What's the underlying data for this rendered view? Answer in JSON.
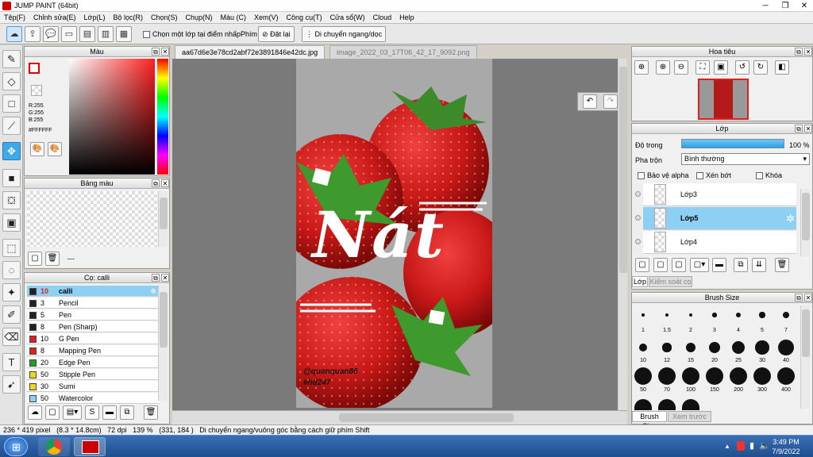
{
  "window": {
    "title": "JUMP PAINT (64bit)"
  },
  "menu": [
    "Tệp(F)",
    "Chỉnh sửa(E)",
    "Lớp(L)",
    "Bộ lọc(R)",
    "Chọn(S)",
    "Chụp(N)",
    "Màu (C)",
    "Xem(V)",
    "Công cụ(T)",
    "Cửa sổ(W)",
    "Cloud",
    "Help"
  ],
  "toolbar": {
    "select_one_layer": "Chọn một lớp tại điểm nhấp",
    "shortcut_label": "Phím",
    "reset_label": "Đặt lại",
    "move_hint": "Di chuyển ngang/dọc"
  },
  "color_panel": {
    "title": "Màu",
    "r": "R:255",
    "g": "G:255",
    "b": "B:255",
    "hex": "#FFFFFF"
  },
  "palette_panel": {
    "title": "Bảng màu",
    "dash": "---"
  },
  "brush_panel": {
    "title": "Cọ: calli",
    "items": [
      {
        "size": "10",
        "name": "calli",
        "color": "#222222"
      },
      {
        "size": "3",
        "name": "Pencil",
        "color": "#222222"
      },
      {
        "size": "5",
        "name": "Pen",
        "color": "#222222"
      },
      {
        "size": "8",
        "name": "Pen (Sharp)",
        "color": "#222222"
      },
      {
        "size": "10",
        "name": "G Pen",
        "color": "#e02020"
      },
      {
        "size": "8",
        "name": "Mapping Pen",
        "color": "#e02020"
      },
      {
        "size": "20",
        "name": "Edge Pen",
        "color": "#20a020"
      },
      {
        "size": "50",
        "name": "Stipple Pen",
        "color": "#e8d820"
      },
      {
        "size": "30",
        "name": "Sumi",
        "color": "#e8d820"
      },
      {
        "size": "50",
        "name": "Watercolor",
        "color": "#8ed0f4"
      }
    ]
  },
  "tabs": [
    "aa67d6e3e78cd2abf72e3891846e42dc.jpg",
    "image_2022_03_17T06_42_17_9092.png"
  ],
  "artwork": {
    "word": "Nát",
    "watermark1": "@quanquan86",
    "watermark2": "#hd247"
  },
  "navigator": {
    "title": "Hoa tiêu"
  },
  "layer_panel": {
    "title": "Lớp",
    "opacity_label": "Độ trong",
    "opacity_value": "100 %",
    "blend_label": "Pha trộn",
    "blend_value": "Bình thường",
    "protect_alpha": "Bảo vệ alpha",
    "clipping": "Xén bớt",
    "lock": "Khóa",
    "layers": [
      {
        "name": "Lớp3",
        "selected": false
      },
      {
        "name": "Lớp5",
        "selected": true
      },
      {
        "name": "Lớp4",
        "selected": false
      }
    ],
    "tab_layer": "Lớp",
    "tab_control": "Kiểm soát cọ"
  },
  "brush_size_panel": {
    "title": "Brush Size",
    "row1": [
      "1",
      "1.5",
      "2",
      "3",
      "4",
      "5",
      "7"
    ],
    "row2": [
      "10",
      "12",
      "15",
      "20",
      "25",
      "30",
      "40"
    ],
    "row3": [
      "50",
      "70",
      "100",
      "150",
      "200",
      "300",
      "400"
    ],
    "tab_size": "Brush Size",
    "tab_preview": "Xem trước cọ"
  },
  "status": {
    "size": "236 * 419 pixel",
    "cm": "(8.3 * 14.8cm)",
    "dpi": "72 dpi",
    "zoom": "139 %",
    "coords": "(331, 184 )",
    "hint": "Di chuyển ngang/vuông góc bằng cách giữ phím Shift"
  },
  "taskbar": {
    "time": "3:49 PM",
    "date": "7/9/2022"
  }
}
